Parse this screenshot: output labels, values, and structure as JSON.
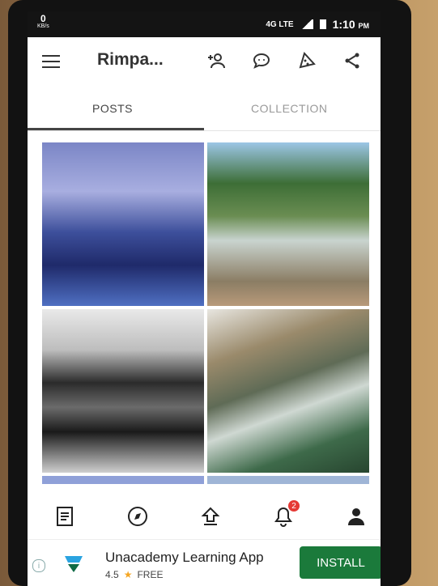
{
  "status": {
    "speed": "0",
    "speed_unit": "KB/s",
    "network": "4G LTE",
    "time": "1:10",
    "ampm": "PM"
  },
  "appbar": {
    "title": "Rimpa...",
    "icons": [
      "menu-icon",
      "add-user-icon",
      "chat-icon",
      "pizza-icon",
      "share-icon"
    ]
  },
  "tabs": [
    {
      "label": "POSTS",
      "selected": true
    },
    {
      "label": "COLLECTION",
      "selected": false
    }
  ],
  "bottomnav": {
    "icons": [
      "document-icon",
      "compass-icon",
      "upload-icon",
      "bell-icon",
      "profile-icon"
    ],
    "notification_count": "2"
  },
  "ad": {
    "app_name": "Unacademy Learning App",
    "rating": "4.5",
    "price": "FREE",
    "install_label": "INSTALL"
  },
  "colors": {
    "install": "#1b7a3b",
    "badge": "#e53935",
    "tab_active": "#444444"
  }
}
